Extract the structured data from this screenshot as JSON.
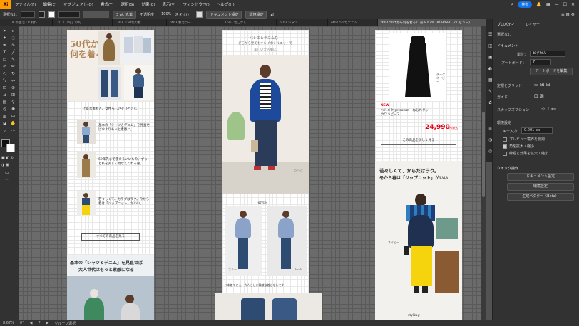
{
  "menubar": {
    "logo": "Ai",
    "items": [
      "ファイル(F)",
      "編集(E)",
      "オブジェクト(O)",
      "書式(T)",
      "選択(S)",
      "効果(C)",
      "表示(V)",
      "ウィンドウ(W)",
      "ヘルプ(H)"
    ],
    "share": "共有"
  },
  "control": {
    "selection": "選択なし",
    "stroke": "3 pt. 丸筆",
    "opacity_label": "不透明度：",
    "opacity": "100%",
    "style_label": "スタイル：",
    "doc_settings": "ドキュメント設定",
    "prefs": "環境設定"
  },
  "tabs": [
    "K 新生活 LP 制作 ...",
    "12/13 「今」の旬 ...",
    "1303 「50代の春 ...",
    "2403 春カラー ...",
    "1603 着こなし ...",
    "2402 シャツ ...",
    "2401 50代 デニム ...",
    "2602 50代から何を着る？ @ 8.67% (RGB/GPU プレビュー)"
  ],
  "artboard1": {
    "title_line1": "50代から",
    "title_line2": "何を着る？",
    "intro": "上質な素材と、女性らしさをひとさじ",
    "item1": "基本の「シャツ＆デニム」を見直せば今よりもっと素敵に。",
    "item2": "50年先まで使えるいいもの。ずっと私を美しく見せてくれる服。",
    "item3": "若々しくて、カラダはラク。今から春は「ジップニット」がいい。",
    "more_button": "すべての商品を見る",
    "banner_line1": "基本の「シャツ＆デニム」を見直せば",
    "banner_line2": "大人世代はもっと素敵になる！"
  },
  "artboard2": {
    "heading_line1": "バレエ＆デニムも",
    "heading_line2": "どこから見てもキレイなシルエットで",
    "sub": "美しい大人服に。",
    "style_label": "-style-",
    "caption_left": "ブルー",
    "caption_right": "back",
    "note": "7本差でさえ、大人らしい素敵な着こなしです"
  },
  "artboard3": {
    "new_badge": "NEW",
    "product_name": "ハルメク premium・ねじれタックワンピース",
    "price": "24,990",
    "price_suffix": "円(税込)",
    "detail_button": "この商品を詳しく見る",
    "color_note": "ダークネイビー",
    "heading_line1": "若々しくて、からだはラク。",
    "heading_line2": "冬から春は「ジップニット」がいい！",
    "photo_note": "ネイビー",
    "styling_label": "-styling-"
  },
  "panel": {
    "tab1": "プロパティ",
    "tab2": "レイヤー",
    "no_selection": "選択なし",
    "document": "ドキュメント",
    "unit_label": "単位：",
    "unit": "ピクセル",
    "artboard_label": "アートボード：",
    "artboard_index": "7",
    "edit_artboard": "アートボードを編集",
    "rulers_grid": "定規とグリッド",
    "guides": "ガイド",
    "snap": "スナップオプション",
    "prefs": "環境設定",
    "keyboard_inc_label": "キー入力：",
    "keyboard_inc": "0.001 px",
    "preview_bounds": "プレビュー境界を使用",
    "scale_corners": "角を拡大・縮小",
    "scale_strokes": "線幅と効果を拡大・縮小",
    "quick_actions": "クイック操作",
    "doc_settings_btn": "ドキュメント設定",
    "prefs_btn": "環境設定",
    "vector_btn": "生成ベクター（Beta）"
  },
  "status": {
    "zoom": "8.67%",
    "rotation": "0°",
    "page": "7",
    "tool": "グループ選択"
  },
  "colors": {
    "ui_dark": "#323232",
    "canvas": "#535353",
    "accent": "#1473e6",
    "price_red": "#e60012",
    "yellow": "#f5d40d"
  }
}
